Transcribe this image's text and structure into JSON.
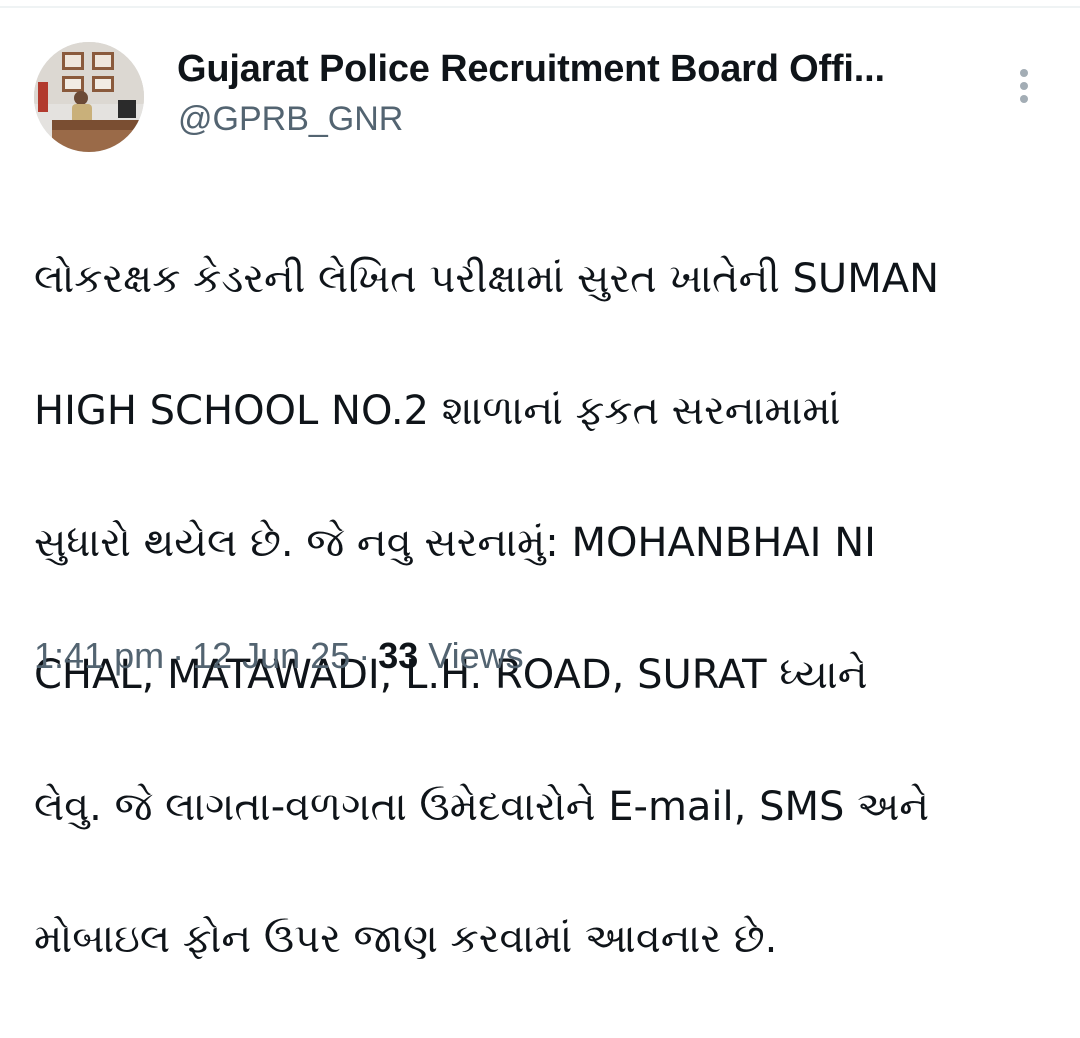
{
  "tweet": {
    "author_name": "Gujarat Police Recruitment Board Offi...",
    "handle": "@GPRB_GNR",
    "more_icon": "more-vertical-icon",
    "body_lines": [
      "લોકરક્ષક કેડરની લેખિત પરીક્ષામાં સુરત ખાતેની SUMAN",
      "HIGH SCHOOL NO.2 શાળાનાં ફકત સરનામામાં",
      "સુધારો થયેલ છે. જે નવુ સરનામું: MOHANBHAI NI",
      "CHAL, MATAWADI, L.H. ROAD, SURAT ધ્યાને",
      "લેવુ. જે લાગતા-વળગતા ઉમેદવારોને E-mail, SMS અને",
      "મોબાઇલ ફોન ઉપર જાણ કરવામાં આવનાર છે."
    ],
    "time": "1:41 pm",
    "date": "12 Jun 25",
    "views_count": "33",
    "views_label": "Views",
    "separator": "·"
  },
  "colors": {
    "text_primary": "#0f1419",
    "text_secondary": "#536471",
    "more_dots": "#a3adb5"
  }
}
